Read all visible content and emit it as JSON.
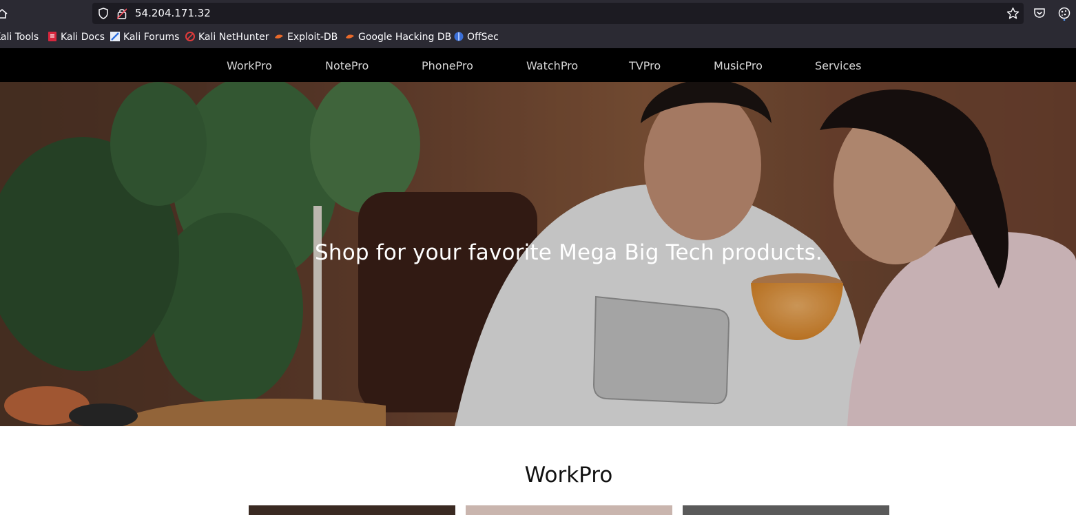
{
  "browser": {
    "url": "54.204.171.32",
    "bookmarks": [
      {
        "label": "Kali Tools",
        "icon": "kali-tools-icon"
      },
      {
        "label": "Kali Docs",
        "icon": "kali-docs-icon"
      },
      {
        "label": "Kali Forums",
        "icon": "kali-forums-icon"
      },
      {
        "label": "Kali NetHunter",
        "icon": "kali-nethunter-icon"
      },
      {
        "label": "Exploit-DB",
        "icon": "exploit-db-icon"
      },
      {
        "label": "Google Hacking DB",
        "icon": "google-hacking-db-icon"
      },
      {
        "label": "OffSec",
        "icon": "offsec-icon"
      }
    ]
  },
  "nav": {
    "items": [
      "WorkPro",
      "NotePro",
      "PhonePro",
      "WatchPro",
      "TVPro",
      "MusicPro",
      "Services"
    ]
  },
  "hero": {
    "headline": "Shop for your favorite Mega Big Tech products."
  },
  "section": {
    "title": "WorkPro"
  },
  "colors": {
    "browser_chrome": "#2b2a33",
    "url_field": "#1c1b22",
    "site_nav": "#000000",
    "nav_text": "#d6d6d6"
  }
}
